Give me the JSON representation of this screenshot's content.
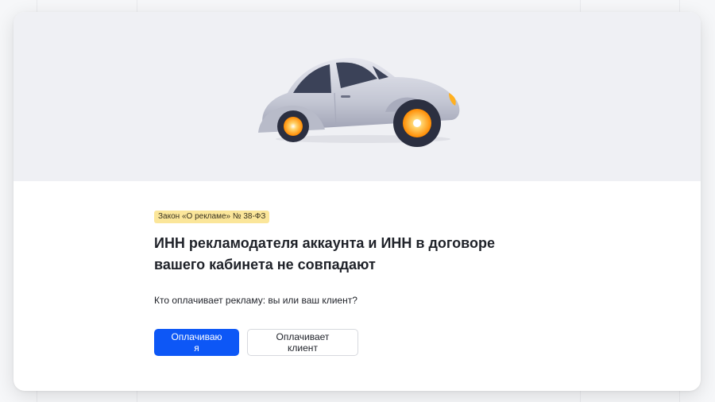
{
  "dialog": {
    "badge": "Закон «О рекламе» № 38-ФЗ",
    "title": "ИНН рекламодателя аккаунта и ИНН в договоре вашего кабинета не совпадают",
    "question": "Кто оплачивает рекламу: вы или ваш клиент?",
    "buttons": {
      "primary": "Оплачиваю я",
      "secondary": "Оплачивает клиент"
    },
    "illustration": "car-icon"
  },
  "colors": {
    "accent": "#0d57f6",
    "badge_bg": "#fbe69a",
    "hero_bg": "#eff0f4"
  }
}
